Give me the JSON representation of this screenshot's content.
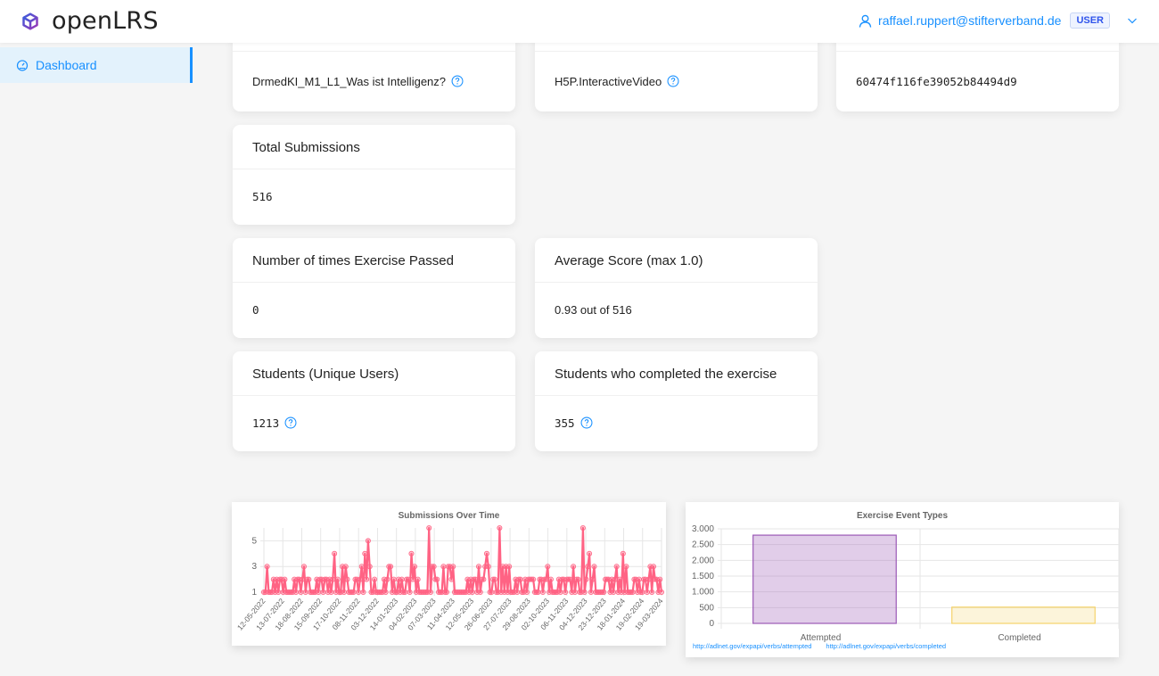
{
  "header": {
    "app_name": "openLRS",
    "user_email": "raffael.ruppert@stifterverband.de",
    "role_badge": "USER",
    "icons": {
      "logo": "cube-logo-icon",
      "user": "user-icon",
      "dropdown": "chevron-down-icon"
    }
  },
  "sidebar": {
    "items": [
      {
        "label": "Dashboard",
        "icon": "dashboard-gauge-icon",
        "active": true
      }
    ]
  },
  "top_cards": [
    {
      "value": "DrmedKI_M1_L1_Was ist Intelligenz?",
      "has_help": true
    },
    {
      "value": "H5P.InteractiveVideo",
      "has_help": true
    },
    {
      "value": "60474f116fe39052b84494d9",
      "has_help": false
    }
  ],
  "stats": {
    "total_submissions": {
      "title": "Total Submissions",
      "value": "516"
    },
    "times_passed": {
      "title": "Number of times Exercise Passed",
      "value": "0"
    },
    "average_score": {
      "title": "Average Score (max 1.0)",
      "value": "0.93 out of 516"
    },
    "unique_students": {
      "title": "Students (Unique Users)",
      "value": "1213"
    },
    "students_completed": {
      "title": "Students who completed the exercise",
      "value": "355"
    }
  },
  "colors": {
    "accent": "#1890ff",
    "line": "#ff6384",
    "bar_attempted": "#9b59b6",
    "bar_completed": "#f5d36b"
  },
  "chart_data": [
    {
      "type": "line",
      "title": "Submissions Over Time",
      "xlabel": "",
      "ylabel": "",
      "ylim": [
        1,
        6
      ],
      "yticks": [
        1,
        3,
        5
      ],
      "grid": true,
      "x_tick_labels": [
        "12-05-2022",
        "13-07-2022",
        "18-08-2022",
        "15-09-2022",
        "17-10-2022",
        "08-11-2022",
        "03-12-2022",
        "14-01-2023",
        "04-02-2023",
        "07-03-2023",
        "11-04-2023",
        "12-05-2023",
        "26-06-2023",
        "27-07-2023",
        "29-08-2023",
        "02-10-2023",
        "06-11-2023",
        "04-12-2023",
        "23-12-2023",
        "18-01-2024",
        "19-02-2024",
        "19-03-2024"
      ],
      "series": [
        {
          "name": "Submissions",
          "values": [
            1,
            1,
            3,
            1,
            1,
            1,
            2,
            1,
            2,
            1,
            2,
            2,
            1,
            2,
            1,
            1,
            1,
            1,
            1,
            2,
            1,
            2,
            2,
            1,
            2,
            3,
            1,
            2,
            2,
            1,
            1,
            1,
            1,
            2,
            1,
            2,
            2,
            1,
            2,
            2,
            1,
            2,
            1,
            2,
            4,
            1,
            2,
            1,
            1,
            3,
            1,
            3,
            2,
            1,
            1,
            1,
            1,
            2,
            2,
            1,
            2,
            3,
            1,
            4,
            2,
            5,
            3,
            1,
            1,
            2,
            1,
            1,
            1,
            1,
            1,
            2,
            1,
            2,
            3,
            3,
            1,
            2,
            1,
            1,
            2,
            1,
            2,
            1,
            1,
            2,
            2,
            1,
            4,
            2,
            3,
            1,
            2,
            1,
            1,
            1,
            1,
            1,
            1,
            6,
            1,
            3,
            3,
            2,
            2,
            1,
            1,
            1,
            3,
            1,
            1,
            3,
            3,
            2,
            3,
            1,
            1,
            1,
            1,
            1,
            1,
            1,
            1,
            2,
            1,
            2,
            1,
            2,
            2,
            1,
            3,
            1,
            2,
            2,
            3,
            4,
            3,
            1,
            1,
            2,
            2,
            1,
            1,
            6,
            1,
            3,
            1,
            3,
            1,
            3,
            1,
            1,
            1,
            2,
            1,
            2,
            2,
            1,
            1,
            2,
            1,
            2,
            2,
            2,
            2,
            1,
            1,
            1,
            2,
            2,
            1,
            2,
            2,
            3,
            1,
            2,
            1,
            1,
            1,
            1,
            2,
            1,
            2,
            2,
            1,
            2,
            2,
            2,
            1,
            3,
            1,
            2,
            2,
            1,
            1,
            6,
            1,
            2,
            3,
            4,
            1,
            2,
            3,
            1,
            1,
            1,
            1,
            1,
            1,
            2,
            2,
            2,
            1,
            2,
            1,
            2,
            3,
            1,
            2,
            1,
            4,
            1,
            3,
            1,
            1,
            1,
            1,
            2,
            2,
            1,
            2,
            1,
            1,
            2,
            2,
            1,
            2,
            3,
            1,
            3,
            2,
            2,
            1,
            2,
            1
          ]
        }
      ]
    },
    {
      "type": "bar",
      "title": "Exercise Event Types",
      "categories": [
        "Attempted",
        "Completed"
      ],
      "values": [
        2800,
        516
      ],
      "ylim": [
        0,
        3000
      ],
      "yticks": [
        "0",
        "500",
        "1.000",
        "1.500",
        "2.000",
        "2.500",
        "3.000"
      ],
      "ytick_values": [
        0,
        500,
        1000,
        1500,
        2000,
        2500,
        3000
      ],
      "grid": true,
      "legend_links": [
        "http://adlnet.gov/expapi/verbs/attempted",
        "http://adlnet.gov/expapi/verbs/completed"
      ]
    }
  ]
}
